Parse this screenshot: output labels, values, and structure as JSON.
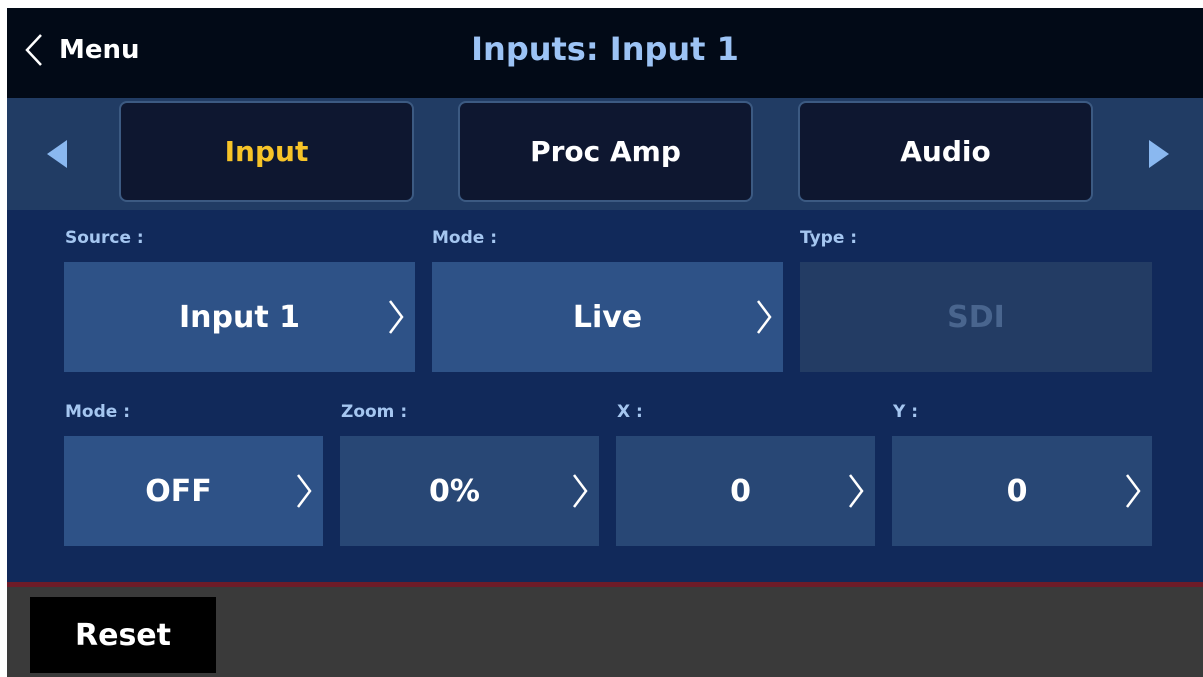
{
  "header": {
    "back_label": "Menu",
    "title": "Inputs: Input 1"
  },
  "tabs": [
    {
      "label": "Input",
      "active": true
    },
    {
      "label": "Proc Amp",
      "active": false
    },
    {
      "label": "Audio",
      "active": false
    }
  ],
  "row1": [
    {
      "label": "Source :",
      "value": "Input 1",
      "state": "active"
    },
    {
      "label": "Mode :",
      "value": "Live",
      "state": "active"
    },
    {
      "label": "Type :",
      "value": "SDI",
      "state": "disabled"
    }
  ],
  "row2": [
    {
      "label": "Mode :",
      "value": "OFF",
      "state": "active"
    },
    {
      "label": "Zoom :",
      "value": "0%",
      "state": "normal"
    },
    {
      "label": "X :",
      "value": "0",
      "state": "normal"
    },
    {
      "label": "Y :",
      "value": "0",
      "state": "normal"
    }
  ],
  "footer": {
    "reset_label": "Reset"
  },
  "colors": {
    "header_bg": "#020a17",
    "title": "#9cc3f5",
    "tabbar_bg": "#213c64",
    "tab_bg": "#0e1730",
    "active_tab_text": "#f7c428",
    "panel_bg": "#11295a",
    "field_bg": "#284775",
    "field_label": "#a5c6f0",
    "arrow": "#8ab8f0",
    "footer_bg": "#3a3a3a"
  },
  "icons": [
    "chevron-left-icon",
    "arrow-left-icon",
    "arrow-right-icon",
    "chevron-right-icon"
  ]
}
